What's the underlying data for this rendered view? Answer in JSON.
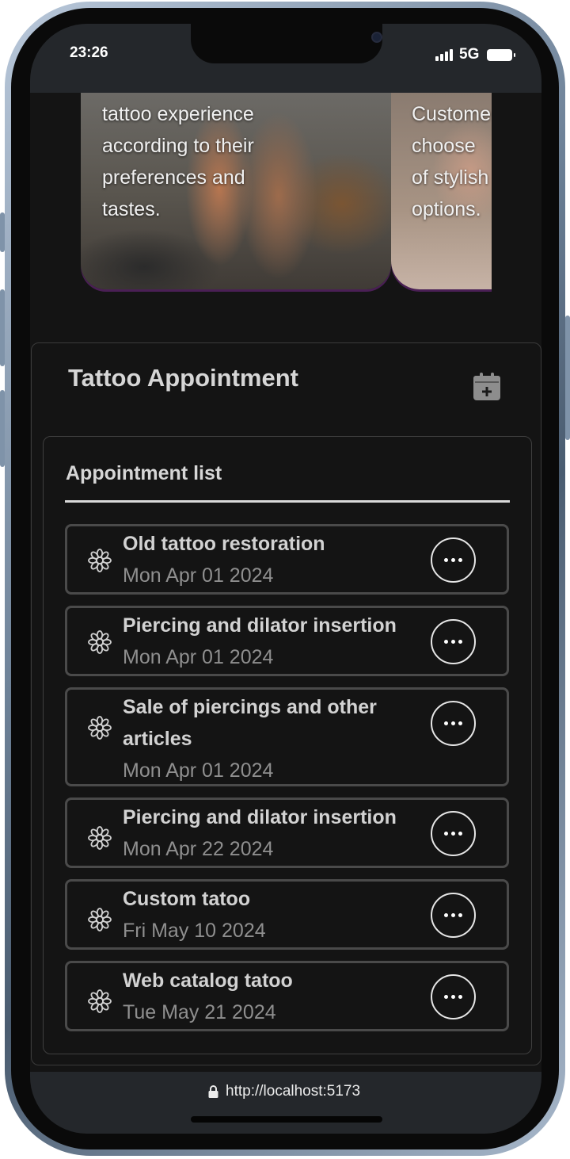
{
  "status_bar": {
    "time": "23:26",
    "network": "5G"
  },
  "carousel": {
    "slides": [
      {
        "text_lines": [
          "tattoo experience",
          "according to their",
          "preferences and",
          "tastes."
        ]
      },
      {
        "text_lines": [
          "Custome",
          "choose",
          "of stylish",
          "options."
        ]
      }
    ]
  },
  "appointment": {
    "title": "Tattoo Appointment",
    "add_icon": "calendar-add-icon",
    "list_header": "Appointment list",
    "items": [
      {
        "title": "Old tattoo restoration",
        "date": "Mon Apr 01 2024",
        "icon": "flower-icon"
      },
      {
        "title": "Piercing and dilator insertion",
        "date": "Mon Apr 01 2024",
        "icon": "flower-icon"
      },
      {
        "title": "Sale of piercings and other articles",
        "date": "Mon Apr 01 2024",
        "icon": "flower-icon"
      },
      {
        "title": "Piercing and dilator insertion",
        "date": "Mon Apr 22 2024",
        "icon": "flower-icon"
      },
      {
        "title": "Custom tatoo",
        "date": "Fri May 10 2024",
        "icon": "flower-icon"
      },
      {
        "title": "Web catalog tatoo",
        "date": "Tue May 21 2024",
        "icon": "flower-icon"
      }
    ]
  },
  "browser": {
    "url": "http://localhost:5173"
  }
}
